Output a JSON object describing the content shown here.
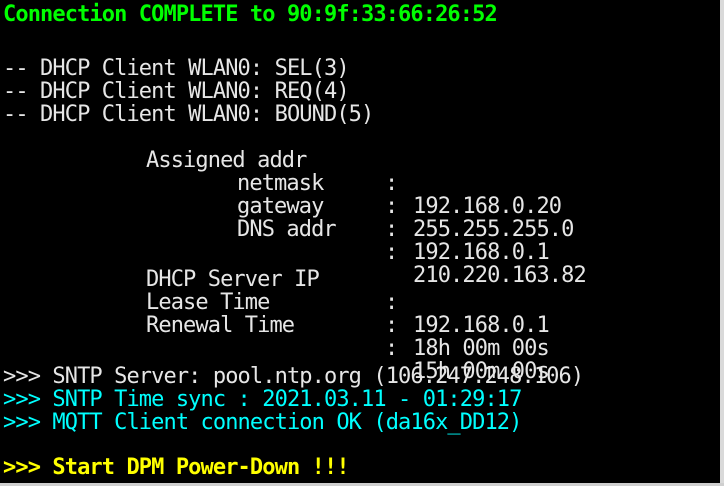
{
  "terminal": {
    "status_line": "Connection COMPLETE to 90:9f:33:66:26:52",
    "dhcp": [
      "-- DHCP Client WLAN0: SEL(3)",
      "-- DHCP Client WLAN0: REQ(4)",
      "-- DHCP Client WLAN0: BOUND(5)"
    ],
    "network": [
      {
        "label": "Assigned addr",
        "value": "192.168.0.20"
      },
      {
        "label": "netmask",
        "value": "255.255.255.0"
      },
      {
        "label": "gateway",
        "value": "192.168.0.1"
      },
      {
        "label": "DNS addr",
        "value": "210.220.163.82"
      }
    ],
    "lease": [
      {
        "label": "DHCP Server IP",
        "value": "192.168.0.1"
      },
      {
        "label": "Lease Time",
        "value": "18h 00m 00s"
      },
      {
        "label": "Renewal Time",
        "value": "15h 00m 00s"
      }
    ],
    "log": [
      ">>> SNTP Server: pool.ntp.org (106.247.248.106)",
      ">>> SNTP Time sync : 2021.03.11 - 01:29:17",
      ">>> MQTT Client connection OK (da16x_DD12)",
      ">>> Start DPM Power-Down !!!"
    ]
  },
  "colors": {
    "background": "#000000",
    "text": "#e6e6e6",
    "status_green": "#00ff00",
    "cyan": "#00ffff",
    "yellow": "#ffff00"
  }
}
